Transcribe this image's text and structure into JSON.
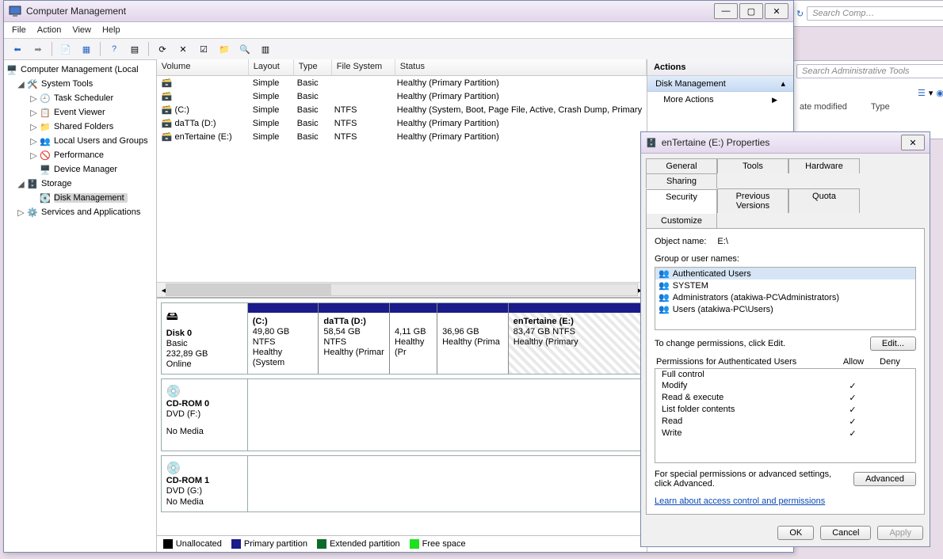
{
  "bg": {
    "search_comp_placeholder": "Search Comp…",
    "search_admin_placeholder": "Search Administrative Tools",
    "col_date": "ate modified",
    "col_type": "Type"
  },
  "window": {
    "title": "Computer Management",
    "menus": [
      "File",
      "Action",
      "View",
      "Help"
    ]
  },
  "tree": {
    "root": "Computer Management (Local",
    "system_tools": "System Tools",
    "task_scheduler": "Task Scheduler",
    "event_viewer": "Event Viewer",
    "shared_folders": "Shared Folders",
    "local_users": "Local Users and Groups",
    "performance": "Performance",
    "device_manager": "Device Manager",
    "storage": "Storage",
    "disk_management": "Disk Management",
    "services_apps": "Services and Applications"
  },
  "vol_headers": {
    "volume": "Volume",
    "layout": "Layout",
    "type": "Type",
    "fs": "File System",
    "status": "Status"
  },
  "volumes": [
    {
      "name": "",
      "layout": "Simple",
      "type": "Basic",
      "fs": "",
      "status": "Healthy (Primary Partition)"
    },
    {
      "name": "",
      "layout": "Simple",
      "type": "Basic",
      "fs": "",
      "status": "Healthy (Primary Partition)"
    },
    {
      "name": "(C:)",
      "layout": "Simple",
      "type": "Basic",
      "fs": "NTFS",
      "status": "Healthy (System, Boot, Page File, Active, Crash Dump, Primary"
    },
    {
      "name": "daTTa (D:)",
      "layout": "Simple",
      "type": "Basic",
      "fs": "NTFS",
      "status": "Healthy (Primary Partition)"
    },
    {
      "name": "enTertaine (E:)",
      "layout": "Simple",
      "type": "Basic",
      "fs": "NTFS",
      "status": "Healthy (Primary Partition)"
    }
  ],
  "disk0": {
    "name": "Disk 0",
    "kind": "Basic",
    "size": "232,89 GB",
    "state": "Online",
    "parts": [
      {
        "label": "(C:)",
        "size": "49,80 GB NTFS",
        "status": "Healthy (System"
      },
      {
        "label": "daTTa  (D:)",
        "size": "58,54 GB NTFS",
        "status": "Healthy (Primar"
      },
      {
        "label": "",
        "size": "4,11 GB",
        "status": "Healthy (Pr"
      },
      {
        "label": "",
        "size": "36,96 GB",
        "status": "Healthy (Prima"
      },
      {
        "label": "enTertaine  (E:)",
        "size": "83,47 GB NTFS",
        "status": "Healthy (Primary"
      }
    ]
  },
  "cd0": {
    "name": "CD-ROM 0",
    "kind": "DVD (F:)",
    "state": "No Media"
  },
  "cd1": {
    "name": "CD-ROM 1",
    "kind": "DVD (G:)",
    "state": "No Media"
  },
  "legend": {
    "unalloc": "Unallocated",
    "primary": "Primary partition",
    "extended": "Extended partition",
    "free": "Free space"
  },
  "actions": {
    "header": "Actions",
    "disk_mgmt": "Disk Management",
    "more": "More Actions"
  },
  "props": {
    "title": "enTertaine (E:) Properties",
    "tabs_row1": [
      "General",
      "Tools",
      "Hardware",
      "Sharing"
    ],
    "tabs_row2": [
      "Security",
      "Previous Versions",
      "Quota",
      "Customize"
    ],
    "active_tab": "Security",
    "object_label": "Object name:",
    "object_value": "E:\\",
    "groups_label": "Group or user names:",
    "groups": [
      "Authenticated Users",
      "SYSTEM",
      "Administrators (atakiwa-PC\\Administrators)",
      "Users (atakiwa-PC\\Users)"
    ],
    "group_selected": 0,
    "edit_hint": "To change permissions, click Edit.",
    "edit_btn": "Edit...",
    "perm_for_prefix": "Permissions for Authenticated Users",
    "allow": "Allow",
    "deny": "Deny",
    "perms": [
      {
        "name": "Full control",
        "allow": false,
        "deny": false
      },
      {
        "name": "Modify",
        "allow": true,
        "deny": false
      },
      {
        "name": "Read & execute",
        "allow": true,
        "deny": false
      },
      {
        "name": "List folder contents",
        "allow": true,
        "deny": false
      },
      {
        "name": "Read",
        "allow": true,
        "deny": false
      },
      {
        "name": "Write",
        "allow": true,
        "deny": false
      }
    ],
    "adv_hint": "For special permissions or advanced settings, click Advanced.",
    "adv_btn": "Advanced",
    "learn_link": "Learn about access control and permissions",
    "ok": "OK",
    "cancel": "Cancel",
    "apply": "Apply"
  }
}
